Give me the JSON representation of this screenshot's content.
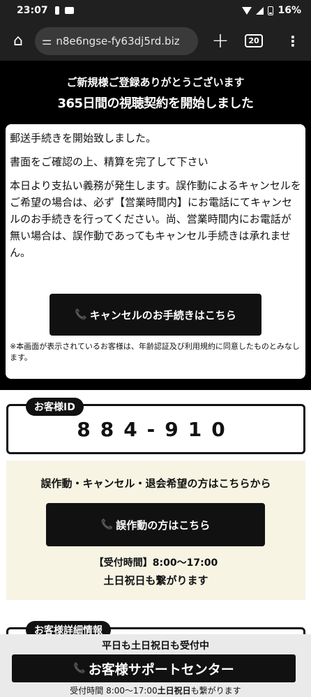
{
  "status_bar": {
    "time": "23:07",
    "battery": "16%"
  },
  "browser": {
    "url": "n8e6ngse-fy63dj5rd.biz",
    "tab_count": "20"
  },
  "hero": {
    "line1": "ご新規様ご登録ありがとうございます",
    "line2": "365日間の視聴契約を開始しました"
  },
  "notice": {
    "p1": "郵送手続きを開始致しました。",
    "p2": "書面をご確認の上、精算を完了して下さい",
    "p3": "本日より支払い義務が発生します。誤作動によるキャンセルをご希望の場合は、必ず【営業時間内】にお電話にてキャンセルのお手続きを行ってください。尚、営業時間内にお電話が無い場合は、誤作動であってもキャンセル手続きは承れません。",
    "cancel_button": "キャンセルのお手続きはこちら",
    "disclaimer": "※本画面が表示されているお客様は、年齢認証及び利用規約に同意したものとみなします。"
  },
  "customer_id": {
    "label": "お客様ID",
    "value": "884-910"
  },
  "mistake_section": {
    "title": "誤作動・キャンセル・退会希望の方はこちらから",
    "button": "誤作動の方はこちら",
    "hours": "【受付時間】8:00～17:00",
    "weekend_a": "土日祝日",
    "weekend_b": "も繋がります"
  },
  "customer_detail": {
    "label": "お客様詳細情報"
  },
  "footer": {
    "top": "平日も土日祝日も受付中",
    "button": "お客様サポートセンター",
    "bottom_a": "受付時間 8:00〜17:00",
    "bottom_b": "土日祝日",
    "bottom_c": "も繋がります"
  }
}
